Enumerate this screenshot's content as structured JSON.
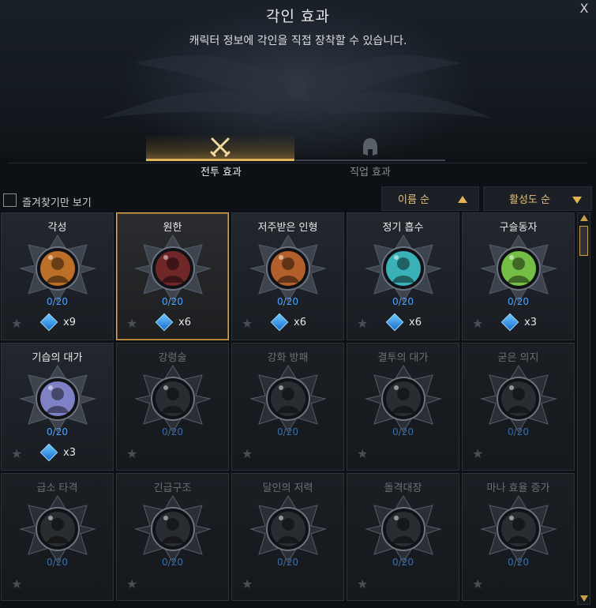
{
  "window": {
    "title": "각인 효과",
    "subtitle": "캐릭터 정보에 각인을 직접 장착할 수 있습니다.",
    "close_label": "X"
  },
  "tabs": [
    {
      "label": "전투 효과",
      "icon": "crossed-swords-icon",
      "active": true
    },
    {
      "label": "직업 효과",
      "icon": "helmet-icon",
      "active": false
    }
  ],
  "toolbar": {
    "favorites_label": "즐겨찾기만 보기",
    "sort_name_label": "이름 순",
    "sort_activation_label": "활성도 순"
  },
  "colors": {
    "accent_gold": "#e0b55a",
    "count_blue": "#4da3ff"
  },
  "engravings": [
    {
      "name": "각성",
      "count": "0/20",
      "multiplier": "x9",
      "owned": true,
      "selected": false,
      "portrait": "#d07a2a"
    },
    {
      "name": "원한",
      "count": "0/20",
      "multiplier": "x6",
      "owned": true,
      "selected": true,
      "portrait": "#7a2a2a"
    },
    {
      "name": "저주받은 인형",
      "count": "0/20",
      "multiplier": "x6",
      "owned": true,
      "selected": false,
      "portrait": "#c4682e"
    },
    {
      "name": "정기 흡수",
      "count": "0/20",
      "multiplier": "x6",
      "owned": true,
      "selected": false,
      "portrait": "#3ec3c8"
    },
    {
      "name": "구슬동자",
      "count": "0/20",
      "multiplier": "x3",
      "owned": true,
      "selected": false,
      "portrait": "#7fd24a"
    },
    {
      "name": "기습의 대가",
      "count": "0/20",
      "multiplier": "x3",
      "owned": true,
      "selected": false,
      "portrait": "#8b8fd8"
    },
    {
      "name": "강령술",
      "count": "0/20",
      "multiplier": "",
      "owned": false,
      "selected": false,
      "portrait": "#3a3d42"
    },
    {
      "name": "강화 방패",
      "count": "0/20",
      "multiplier": "",
      "owned": false,
      "selected": false,
      "portrait": "#3a3d42"
    },
    {
      "name": "결투의 대가",
      "count": "0/20",
      "multiplier": "",
      "owned": false,
      "selected": false,
      "portrait": "#3a3d42"
    },
    {
      "name": "굳은 의지",
      "count": "0/20",
      "multiplier": "",
      "owned": false,
      "selected": false,
      "portrait": "#3a3d42"
    },
    {
      "name": "급소 타격",
      "count": "0/20",
      "multiplier": "",
      "owned": false,
      "selected": false,
      "portrait": "#3a3d42"
    },
    {
      "name": "긴급구조",
      "count": "0/20",
      "multiplier": "",
      "owned": false,
      "selected": false,
      "portrait": "#3a3d42"
    },
    {
      "name": "달인의 저력",
      "count": "0/20",
      "multiplier": "",
      "owned": false,
      "selected": false,
      "portrait": "#3a3d42"
    },
    {
      "name": "돌격대장",
      "count": "0/20",
      "multiplier": "",
      "owned": false,
      "selected": false,
      "portrait": "#3a3d42"
    },
    {
      "name": "마나 효율 증가",
      "count": "0/20",
      "multiplier": "",
      "owned": false,
      "selected": false,
      "portrait": "#3a3d42"
    }
  ]
}
